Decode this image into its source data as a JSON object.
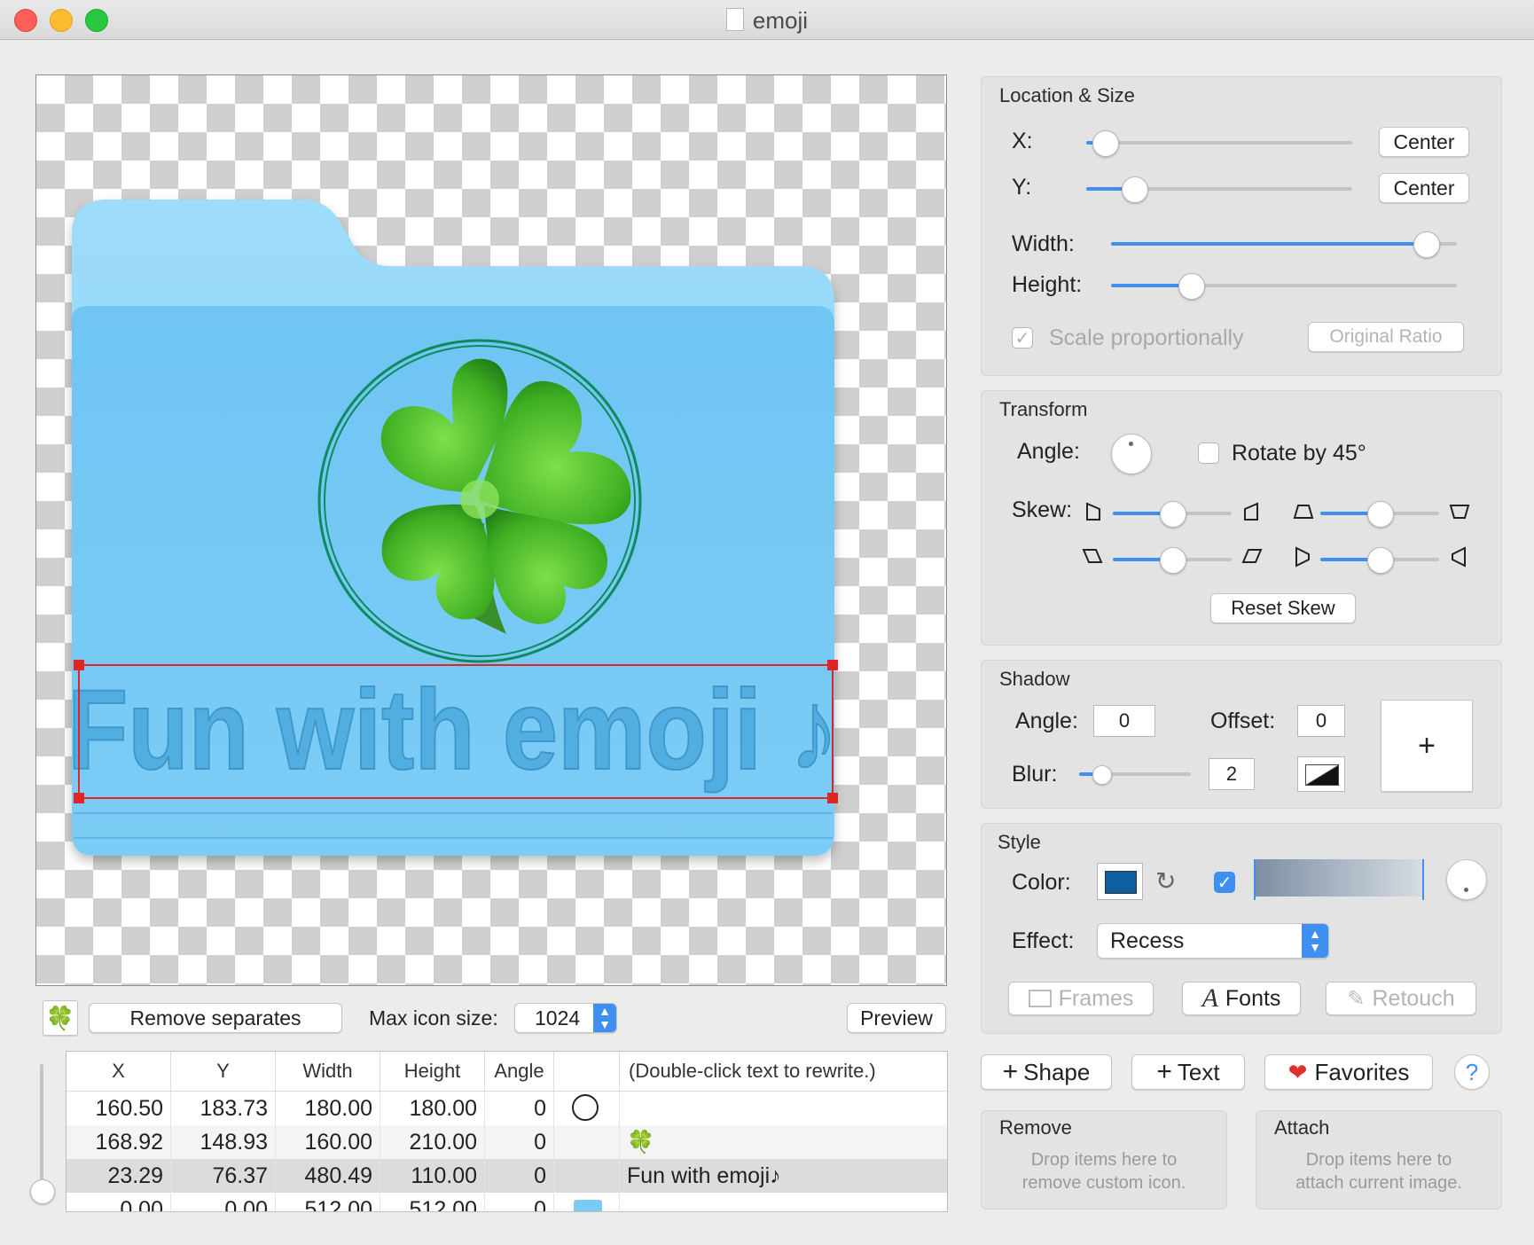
{
  "window": {
    "title": "emoji"
  },
  "canvas": {
    "caption_text": "Fun with emoji ♪",
    "emoji": "🍀"
  },
  "bottom_bar": {
    "emoji_thumb": "🍀",
    "remove_separates": "Remove separates",
    "max_icon_size_label": "Max icon size:",
    "max_icon_size_value": "1024",
    "preview": "Preview"
  },
  "table": {
    "headers": [
      "X",
      "Y",
      "Width",
      "Height",
      "Angle",
      "",
      "(Double-click text to rewrite.)"
    ],
    "rows": [
      {
        "x": "160.50",
        "y": "183.73",
        "width": "180.00",
        "height": "180.00",
        "angle": "0",
        "content": ""
      },
      {
        "x": "168.92",
        "y": "148.93",
        "width": "160.00",
        "height": "210.00",
        "angle": "0",
        "content": "🍀"
      },
      {
        "x": "23.29",
        "y": "76.37",
        "width": "480.49",
        "height": "110.00",
        "angle": "0",
        "content": "Fun with emoji♪"
      },
      {
        "x": "0.00",
        "y": "0.00",
        "width": "512.00",
        "height": "512.00",
        "angle": "0",
        "content": ""
      }
    ]
  },
  "location_size": {
    "title": "Location & Size",
    "x_label": "X:",
    "x_value": 0.07,
    "y_label": "Y:",
    "y_value": 0.18,
    "center_label": "Center",
    "width_label": "Width:",
    "width_value": 0.91,
    "height_label": "Height:",
    "height_value": 0.23,
    "scale_proportionally": "Scale proportionally",
    "original_ratio": "Original Ratio"
  },
  "transform": {
    "title": "Transform",
    "angle_label": "Angle:",
    "rotate_45": "Rotate by 45°",
    "skew_label": "Skew:",
    "skew_values": [
      0.5,
      0.5,
      0.5,
      0.5
    ],
    "reset_skew": "Reset Skew"
  },
  "shadow": {
    "title": "Shadow",
    "angle_label": "Angle:",
    "angle_value": "0",
    "offset_label": "Offset:",
    "offset_value": "0",
    "blur_label": "Blur:",
    "blur_value": "2",
    "blur_slider": 0.2,
    "add_symbol": "+"
  },
  "style": {
    "title": "Style",
    "color_label": "Color:",
    "color_swatch": "#0f5ea0",
    "effect_label": "Effect:",
    "effect_value": "Recess",
    "frames": "Frames",
    "fonts": "Fonts",
    "retouch": "Retouch"
  },
  "actions": {
    "shape": "Shape",
    "text": "Text",
    "favorites": "Favorites",
    "help": "?"
  },
  "drop_remove": {
    "title": "Remove",
    "line1": "Drop items here to",
    "line2": "remove custom icon."
  },
  "drop_attach": {
    "title": "Attach",
    "line1": "Drop items here to",
    "line2": "attach current image."
  },
  "colors": {
    "accent": "#3f8ff0",
    "folder_light": "#9adcfb",
    "folder_mid": "#79cbf5",
    "selection": "#e02424"
  }
}
